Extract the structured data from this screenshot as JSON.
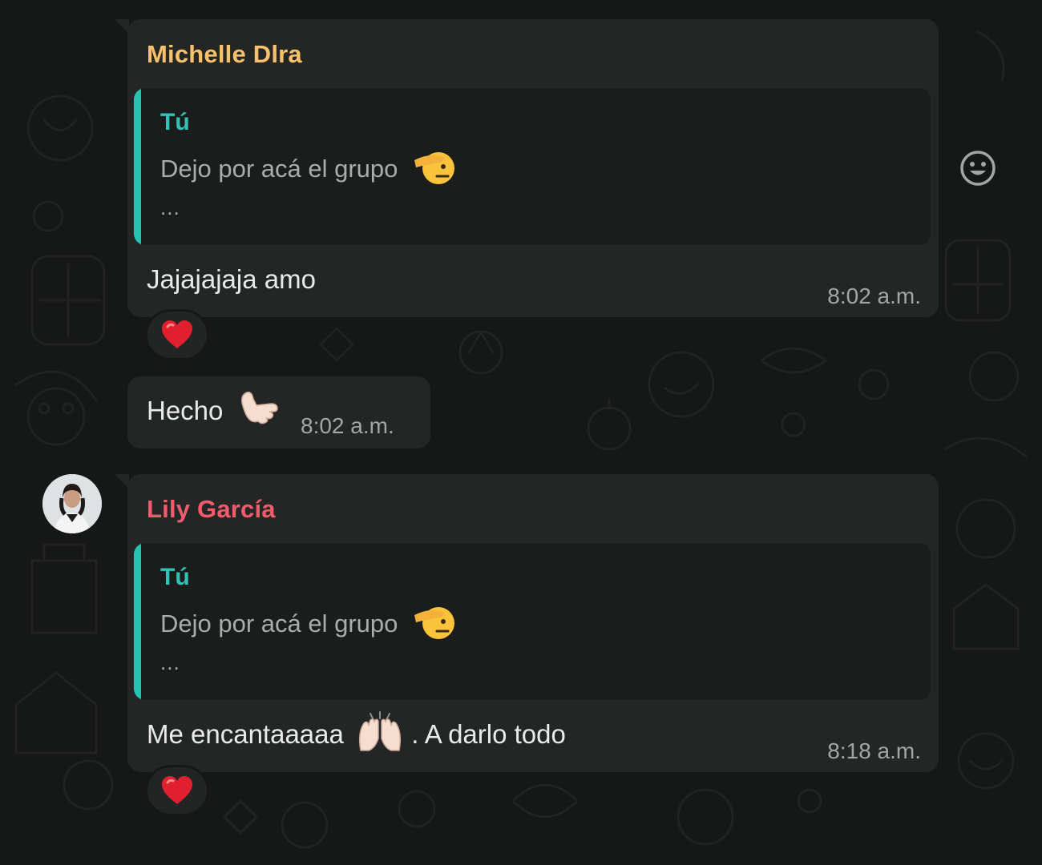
{
  "colors": {
    "background": "#161717",
    "bubble": "#242626",
    "quote_background": "#1b1c1c",
    "quote_bar": "#25c2b0",
    "sender_michelle": "#f7c26b",
    "sender_lily": "#f15c6d",
    "quote_author": "#2ec4b6",
    "text": "#e9eaea",
    "meta": "#a2a6a6"
  },
  "messages": [
    {
      "sender": "Michelle Dlra",
      "quote": {
        "author": "Tú",
        "text": "Dejo por acá el grupo",
        "emoji": "saluting-face-icon",
        "more": "..."
      },
      "text": "Jajajajaja amo",
      "time": "8:02 a.m.",
      "reaction": "red-heart-icon"
    },
    {
      "text": "Hecho",
      "emoji": "call-me-hand-icon",
      "time": "8:02 a.m."
    },
    {
      "sender": "Lily García",
      "quote": {
        "author": "Tú",
        "text": "Dejo por acá el grupo",
        "emoji": "saluting-face-icon",
        "more": "..."
      },
      "text_before": "Me encantaaaaa",
      "emoji": "raising-hands-icon",
      "text_after": ". A darlo todo",
      "time": "8:18 a.m.",
      "reaction": "red-heart-icon"
    }
  ],
  "hover_action_icon": "smiley-react-icon",
  "avatar_icon": "avatar-lily"
}
